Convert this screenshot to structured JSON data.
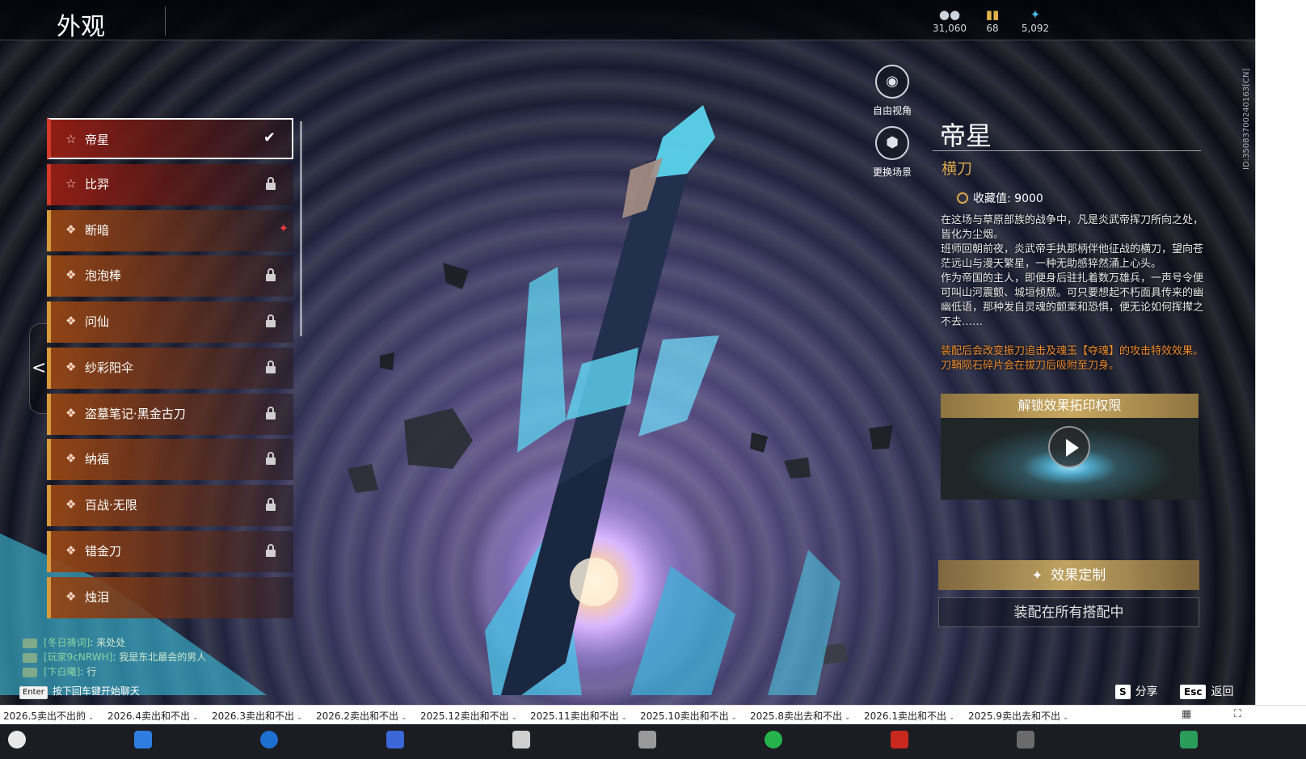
{
  "header": {
    "title": "外观",
    "currencies": [
      {
        "icon": "coin-stack-icon",
        "value": "31,060"
      },
      {
        "icon": "ticket-icon",
        "value": "68"
      },
      {
        "icon": "feather-icon",
        "value": "5,092"
      }
    ]
  },
  "list": {
    "items": [
      {
        "label": "帝星",
        "state": "selected",
        "rarity": "red"
      },
      {
        "label": "比羿",
        "state": "locked",
        "rarity": "red"
      },
      {
        "label": "断暗",
        "state": "new",
        "rarity": "gold"
      },
      {
        "label": "泡泡棒",
        "state": "locked",
        "rarity": "gold"
      },
      {
        "label": "问仙",
        "state": "locked",
        "rarity": "gold"
      },
      {
        "label": "纱彩阳伞",
        "state": "locked",
        "rarity": "gold"
      },
      {
        "label": "盗墓笔记·黑金古刀",
        "state": "locked",
        "rarity": "gold"
      },
      {
        "label": "纳福",
        "state": "locked",
        "rarity": "gold"
      },
      {
        "label": "百战·无限",
        "state": "locked",
        "rarity": "gold"
      },
      {
        "label": "错金刀",
        "state": "locked",
        "rarity": "gold"
      },
      {
        "label": "烛泪",
        "state": "none",
        "rarity": "gold"
      }
    ],
    "collapse_glyph": "<"
  },
  "camera": {
    "free_view": "自由视角",
    "change_scene": "更换场景"
  },
  "detail": {
    "title": "帝星",
    "type": "横刀",
    "collect_label": "收藏值: 9000",
    "description": "在这场与草原部族的战争中，凡是炎武帝挥刀所向之处，皆化为尘烟。\n班师回朝前夜，炎武帝手执那柄伴他征战的横刀，望向苍茫远山与漫天繁星，一种无助感猝然涌上心头。\n作为帝国的主人，即便身后驻扎着数万雄兵，一声号令便可叫山河震颤、城垣倾颓。可只要想起不朽面具传来的幽幽低语，那种发自灵魂的颤栗和恐惧，便无论如何挥撵之不去……",
    "effect": "装配后会改变振刀追击及魂玉【夺魂】的攻击特效效果。\n刀鞘陨石碎片会在拔刀后吸附至刀身。",
    "video_title": "解锁效果拓印权限",
    "custom_button": "效果定制",
    "equip_status": "装配在所有搭配中"
  },
  "hotkeys": [
    {
      "key": "S",
      "label": "分享"
    },
    {
      "key": "Esc",
      "label": "返回"
    }
  ],
  "side_id": "ID:3508370024016​3[CN]",
  "chat": {
    "lines": [
      {
        "who": "[冬日祷词]",
        "text": "来处处"
      },
      {
        "who": "[玩家9cNRWH]",
        "text": "我是东北最会的男人"
      },
      {
        "who": "[卞白曦]",
        "text": "行"
      }
    ],
    "hint_key": "Enter",
    "hint": "按下回车键开始聊天"
  },
  "bookmarks": [
    "2026.5卖出不出的",
    "2026.4卖出和不出",
    "2026.3卖出和不出",
    "2026.2卖出和不出",
    "2025.12卖出和不出",
    "2025.11卖出和不出",
    "2025.10卖出和不出",
    "2025.8卖出去和不出",
    "2026.1卖出和不出",
    "2025.9卖出去和不出"
  ],
  "colors": {
    "accent_gold": "#d9a64c",
    "effect_orange": "#ec8a2a",
    "rarity_red": "#d33a2a",
    "rarity_gold": "#d79a3c"
  }
}
